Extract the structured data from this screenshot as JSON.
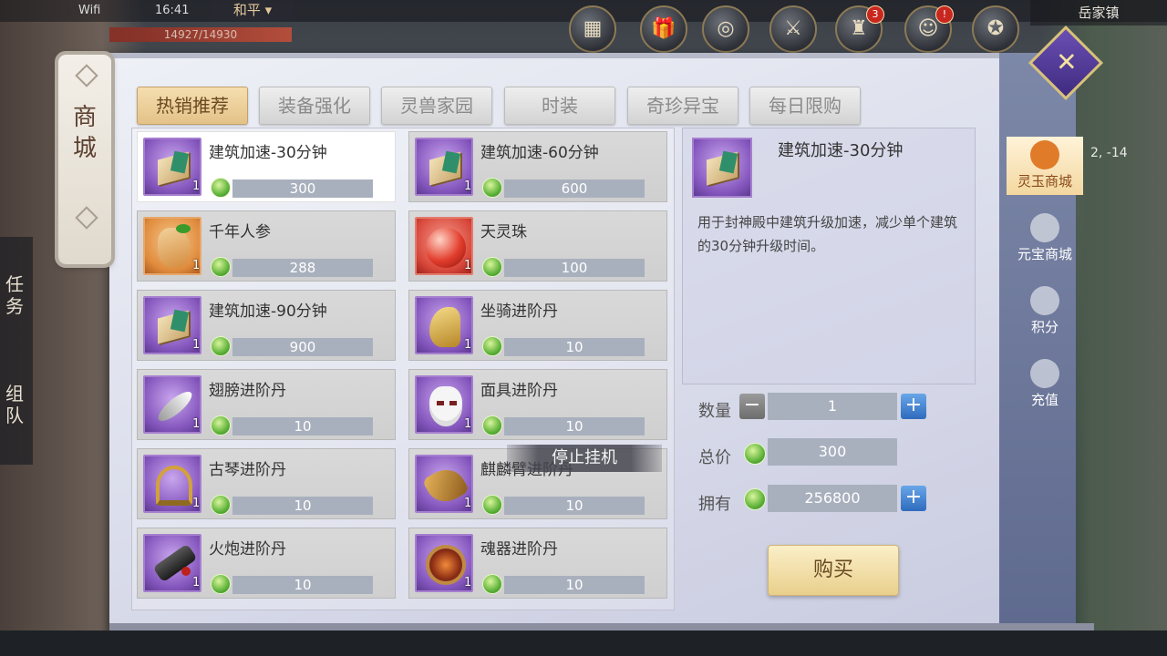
{
  "status": {
    "wifi": "Wifi",
    "time": "16:41",
    "mode": "和平",
    "hp": "14927/14930",
    "location": "岳家镇",
    "coords": "2, -14"
  },
  "top_icons": [
    {
      "name": "calendar-icon",
      "glyph": "▦",
      "badge": ""
    },
    {
      "name": "gift-icon",
      "glyph": "🎁",
      "badge": ""
    },
    {
      "name": "target-icon",
      "glyph": "◎",
      "badge": ""
    },
    {
      "name": "crossed-swords-icon",
      "glyph": "⚔",
      "badge": ""
    },
    {
      "name": "reward-icon",
      "glyph": "♜",
      "badge": "3"
    },
    {
      "name": "character-icon",
      "glyph": "☺",
      "badge": "!"
    },
    {
      "name": "emblem-icon",
      "glyph": "✪",
      "badge": ""
    }
  ],
  "left_panel": {
    "title": "商城",
    "quest": "任务",
    "team": "组队"
  },
  "tabs": [
    "热销推荐",
    "装备强化",
    "灵兽家园",
    "时装",
    "奇珍异宝",
    "每日限购"
  ],
  "items": [
    {
      "name": "建筑加速-30分钟",
      "qty": "1",
      "price": "300",
      "icon": "book-icon"
    },
    {
      "name": "建筑加速-60分钟",
      "qty": "1",
      "price": "600",
      "icon": "book-icon"
    },
    {
      "name": "千年人参",
      "qty": "1",
      "price": "288",
      "icon": "ginseng-icon"
    },
    {
      "name": "天灵珠",
      "qty": "1",
      "price": "100",
      "icon": "pearl-icon"
    },
    {
      "name": "建筑加速-90分钟",
      "qty": "1",
      "price": "900",
      "icon": "book-icon"
    },
    {
      "name": "坐骑进阶丹",
      "qty": "1",
      "price": "10",
      "icon": "horse-icon"
    },
    {
      "name": "翅膀进阶丹",
      "qty": "1",
      "price": "10",
      "icon": "feather-icon"
    },
    {
      "name": "面具进阶丹",
      "qty": "1",
      "price": "10",
      "icon": "mask-icon"
    },
    {
      "name": "古琴进阶丹",
      "qty": "1",
      "price": "10",
      "icon": "harp-icon"
    },
    {
      "name": "麒麟臂进阶丹",
      "qty": "1",
      "price": "10",
      "icon": "claw-icon"
    },
    {
      "name": "火炮进阶丹",
      "qty": "1",
      "price": "10",
      "icon": "cannon-icon"
    },
    {
      "name": "魂器进阶丹",
      "qty": "1",
      "price": "10",
      "icon": "soul-icon"
    }
  ],
  "idle_label": "停止挂机",
  "detail": {
    "name": "建筑加速-30分钟",
    "description": "用于封神殿中建筑升级加速，减少单个建筑的30分钟升级时间。",
    "qty_label": "数量",
    "qty": "1",
    "total_label": "总价",
    "total": "300",
    "owned_label": "拥有",
    "owned": "256800",
    "buy_label": "购买"
  },
  "side_tabs": [
    "灵玉商城",
    "元宝商城",
    "积分",
    "充值"
  ]
}
